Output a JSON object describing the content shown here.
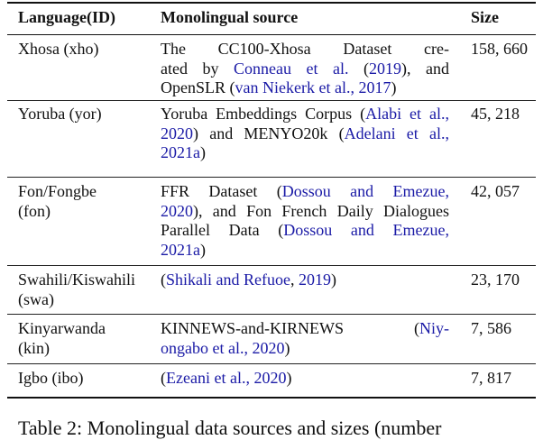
{
  "table": {
    "headers": {
      "language": "Language(ID)",
      "source": "Monolingual source",
      "size": "Size"
    },
    "rows": [
      {
        "language": [
          "Xhosa (xho)"
        ],
        "source": [
          [
            {
              "t": "The CC100-Xhosa Dataset cre-"
            }
          ],
          [
            {
              "t": "ated by "
            },
            {
              "t": "Conneau et al.",
              "cite": true
            },
            {
              "t": " ("
            },
            {
              "t": "2019",
              "cite": true
            },
            {
              "t": "), and"
            }
          ],
          [
            {
              "t": "OpenSLR ("
            },
            {
              "t": "van Niekerk et al., 2017",
              "cite": true
            },
            {
              "t": ")"
            }
          ]
        ],
        "size": "158, 660"
      },
      {
        "language": [
          "Yoruba (yor)"
        ],
        "source": [
          [
            {
              "t": "Yoruba Embeddings Corpus ("
            },
            {
              "t": "Alabi et al.,",
              "cite": true
            }
          ],
          [
            {
              "t": "2020",
              "cite": true
            },
            {
              "t": ") and MENYO20k ("
            },
            {
              "t": "Adelani et al.,",
              "cite": true
            }
          ],
          [
            {
              "t": "2021a",
              "cite": true
            },
            {
              "t": ")"
            }
          ]
        ],
        "size": "45, 218"
      },
      {
        "language": [
          "Fon/Fongbe",
          "(fon)"
        ],
        "source": [
          [
            {
              "t": "FFR Dataset ("
            },
            {
              "t": "Dossou and Emezue,",
              "cite": true
            }
          ],
          [
            {
              "t": "2020",
              "cite": true
            },
            {
              "t": "), and Fon French Daily Dialogues"
            }
          ],
          [
            {
              "t": "Parallel Data ("
            },
            {
              "t": "Dossou and Emezue,",
              "cite": true
            }
          ],
          [
            {
              "t": "2021a",
              "cite": true
            },
            {
              "t": ")"
            }
          ]
        ],
        "size": "42, 057"
      },
      {
        "language": [
          "Swahili/Kiswahili",
          "(swa)"
        ],
        "source": [
          [
            {
              "t": "("
            },
            {
              "t": "Shikali and Refuoe",
              "cite": true
            },
            {
              "t": ", "
            },
            {
              "t": "2019",
              "cite": true
            },
            {
              "t": ")"
            }
          ]
        ],
        "size": "23, 170"
      },
      {
        "language": [
          "Kinyarwanda",
          "(kin)"
        ],
        "source": [
          [
            {
              "t": "KINNEWS-and-KIRNEWS ("
            },
            {
              "t": "Niy-",
              "cite": true
            }
          ],
          [
            {
              "t": "ongabo et al., 2020",
              "cite": true
            },
            {
              "t": ")"
            }
          ]
        ],
        "size": "7, 586"
      },
      {
        "language": [
          "Igbo (ibo)"
        ],
        "source": [
          [
            {
              "t": "("
            },
            {
              "t": "Ezeani et al., 2020",
              "cite": true
            },
            {
              "t": ")"
            }
          ]
        ],
        "size": "7, 817"
      }
    ]
  },
  "caption": "Table 2: Monolingual data sources and sizes (number"
}
